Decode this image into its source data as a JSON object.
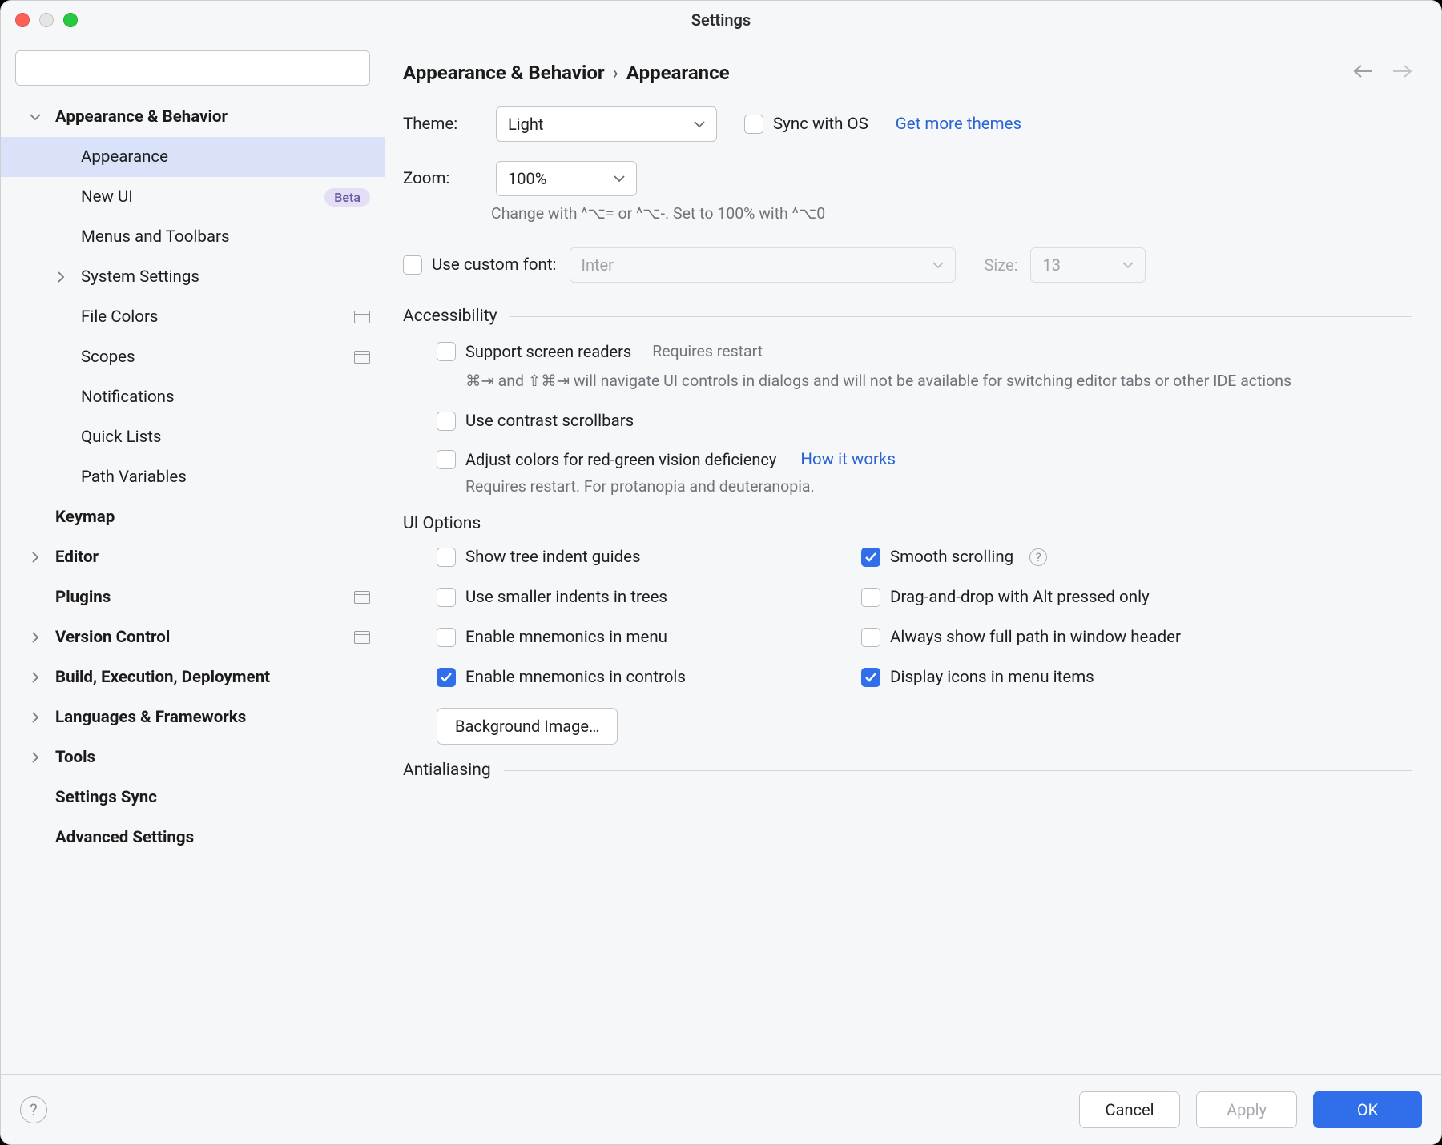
{
  "window": {
    "title": "Settings"
  },
  "search": {
    "placeholder": ""
  },
  "sidebar": {
    "items": [
      {
        "label": "Appearance & Behavior",
        "level": 1,
        "expandable": true,
        "expanded": true
      },
      {
        "label": "Appearance",
        "level": 2,
        "selected": true
      },
      {
        "label": "New UI",
        "level": 2,
        "badge": "Beta"
      },
      {
        "label": "Menus and Toolbars",
        "level": 2
      },
      {
        "label": "System Settings",
        "level": 2,
        "expandable": true,
        "expanded": false
      },
      {
        "label": "File Colors",
        "level": 2,
        "config_icon": true
      },
      {
        "label": "Scopes",
        "level": 2,
        "config_icon": true
      },
      {
        "label": "Notifications",
        "level": 2
      },
      {
        "label": "Quick Lists",
        "level": 2
      },
      {
        "label": "Path Variables",
        "level": 2
      },
      {
        "label": "Keymap",
        "level": 1
      },
      {
        "label": "Editor",
        "level": 1,
        "expandable": true
      },
      {
        "label": "Plugins",
        "level": 1,
        "config_icon": true
      },
      {
        "label": "Version Control",
        "level": 1,
        "expandable": true,
        "config_icon": true
      },
      {
        "label": "Build, Execution, Deployment",
        "level": 1,
        "expandable": true
      },
      {
        "label": "Languages & Frameworks",
        "level": 1,
        "expandable": true
      },
      {
        "label": "Tools",
        "level": 1,
        "expandable": true
      },
      {
        "label": "Settings Sync",
        "level": 1
      },
      {
        "label": "Advanced Settings",
        "level": 1
      }
    ]
  },
  "breadcrumb": {
    "parent": "Appearance & Behavior",
    "current": "Appearance"
  },
  "form": {
    "theme_label": "Theme:",
    "theme_value": "Light",
    "sync_os_label": "Sync with OS",
    "get_themes_link": "Get more themes",
    "zoom_label": "Zoom:",
    "zoom_value": "100%",
    "zoom_hint": "Change with ^⌥= or ^⌥-. Set to 100% with ^⌥0",
    "custom_font_label": "Use custom font:",
    "font_value": "Inter",
    "size_label": "Size:",
    "size_value": "13"
  },
  "accessibility": {
    "title": "Accessibility",
    "screen_readers_label": "Support screen readers",
    "requires_restart": "Requires restart",
    "screen_readers_hint": "⌘⇥ and ⇧⌘⇥ will navigate UI controls in dialogs and will not be available for switching editor tabs or other IDE actions",
    "contrast_scrollbars": "Use contrast scrollbars",
    "adjust_colors_label": "Adjust colors for red-green vision deficiency",
    "how_it_works": "How it works",
    "adjust_colors_hint": "Requires restart. For protanopia and deuteranopia."
  },
  "ui_options": {
    "title": "UI Options",
    "tree_indent": "Show tree indent guides",
    "smooth_scroll": "Smooth scrolling",
    "smaller_indents": "Use smaller indents in trees",
    "dnd_alt": "Drag-and-drop with Alt pressed only",
    "mnemonics_menu": "Enable mnemonics in menu",
    "full_path": "Always show full path in window header",
    "mnemonics_controls": "Enable mnemonics in controls",
    "display_icons": "Display icons in menu items",
    "bg_image_btn": "Background Image…"
  },
  "antialiasing": {
    "title": "Antialiasing"
  },
  "footer": {
    "cancel": "Cancel",
    "apply": "Apply",
    "ok": "OK"
  }
}
